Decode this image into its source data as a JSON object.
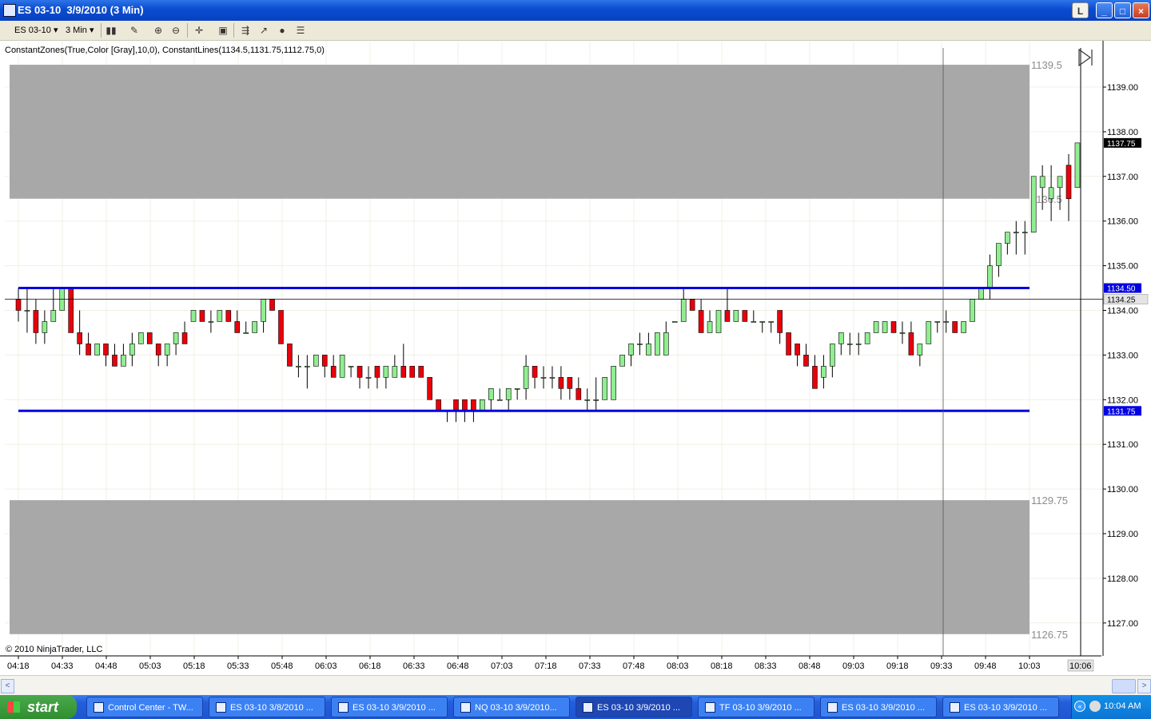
{
  "window": {
    "title": "ES 03-10  3/9/2010 (3 Min)",
    "buttons": {
      "l": "L",
      "minimize": "_",
      "maximize": "□",
      "close": "×"
    }
  },
  "toolbar": {
    "instrument": "ES 03-10",
    "interval": "3 Min",
    "icons": [
      "candlestick-icon",
      "pencil-draw-icon",
      "zoom-in-icon",
      "zoom-out-icon",
      "crosshair-icon",
      "properties-icon",
      "strategy-icon",
      "indicator-icon",
      "circle-icon",
      "data-box-icon"
    ]
  },
  "chart_data": {
    "type": "candlestick",
    "indicator_label": "ConstantZones(True,Color [Gray],10,0), ConstantLines(1134.5,1131.75,1112.75,0)",
    "copyright": "© 2010 NinjaTrader, LLC",
    "ylim": [
      1126.5,
      1139.75
    ],
    "y_ticks": [
      "1139.00",
      "1138.00",
      "1137.00",
      "1136.00",
      "1135.00",
      "1134.00",
      "1133.00",
      "1132.00",
      "1131.00",
      "1130.00",
      "1129.00",
      "1128.00",
      "1127.00"
    ],
    "x_ticks": [
      "04:18",
      "04:33",
      "04:48",
      "05:03",
      "05:18",
      "05:33",
      "05:48",
      "06:03",
      "06:18",
      "06:33",
      "06:48",
      "07:03",
      "07:18",
      "07:33",
      "07:48",
      "08:03",
      "08:18",
      "08:33",
      "08:48",
      "09:03",
      "09:18",
      "09:33",
      "09:48",
      "10:03"
    ],
    "x_end_label": "10:06",
    "zones": [
      {
        "from": 1136.5,
        "to": 1139.5,
        "color": "#a8a8a8",
        "top_label": "1139.5",
        "bottom_label": "1136.5"
      },
      {
        "from": 1126.75,
        "to": 1129.75,
        "color": "#a8a8a8",
        "top_label": "1129.75",
        "bottom_label": "1126.75"
      }
    ],
    "lines": [
      {
        "value": 1134.5,
        "color": "#0000e0",
        "label": "1134.50"
      },
      {
        "value": 1131.75,
        "color": "#0000e0",
        "label": "1131.75"
      }
    ],
    "last_price": {
      "value": 1137.75,
      "label": "1137.75"
    },
    "crosshair": {
      "value": 1134.25,
      "label": "1134.25",
      "time": "09:33"
    },
    "up_color": "#90ee90",
    "down_color": "#e8000b",
    "candles": [
      [
        1134.25,
        1134.5,
        1133.75,
        1134.0
      ],
      [
        1134.0,
        1134.5,
        1133.5,
        1134.0
      ],
      [
        1134.0,
        1134.25,
        1133.25,
        1133.5
      ],
      [
        1133.5,
        1134.0,
        1133.25,
        1133.75
      ],
      [
        1133.75,
        1134.5,
        1133.75,
        1134.0
      ],
      [
        1134.0,
        1134.5,
        1134.0,
        1134.5
      ],
      [
        1134.5,
        1134.5,
        1133.5,
        1133.5
      ],
      [
        1133.5,
        1134.0,
        1133.0,
        1133.25
      ],
      [
        1133.25,
        1133.5,
        1133.0,
        1133.0
      ],
      [
        1133.0,
        1133.25,
        1133.0,
        1133.25
      ],
      [
        1133.25,
        1133.25,
        1132.75,
        1133.0
      ],
      [
        1133.0,
        1133.25,
        1132.75,
        1132.75
      ],
      [
        1132.75,
        1133.25,
        1132.75,
        1133.0
      ],
      [
        1133.0,
        1133.5,
        1132.75,
        1133.25
      ],
      [
        1133.25,
        1133.5,
        1133.25,
        1133.5
      ],
      [
        1133.5,
        1133.5,
        1133.25,
        1133.25
      ],
      [
        1133.25,
        1133.25,
        1132.75,
        1133.0
      ],
      [
        1133.0,
        1133.25,
        1132.75,
        1133.25
      ],
      [
        1133.25,
        1133.5,
        1133.0,
        1133.5
      ],
      [
        1133.5,
        1133.75,
        1133.25,
        1133.25
      ],
      [
        1133.75,
        1134.0,
        1133.75,
        1134.0
      ],
      [
        1134.0,
        1134.0,
        1133.75,
        1133.75
      ],
      [
        1133.75,
        1134.0,
        1133.5,
        1133.75
      ],
      [
        1133.75,
        1134.0,
        1133.75,
        1134.0
      ],
      [
        1134.0,
        1134.0,
        1133.75,
        1133.75
      ],
      [
        1133.75,
        1134.0,
        1133.5,
        1133.5
      ],
      [
        1133.5,
        1133.75,
        1133.5,
        1133.5
      ],
      [
        1133.5,
        1133.75,
        1133.5,
        1133.75
      ],
      [
        1133.75,
        1134.25,
        1133.5,
        1134.25
      ],
      [
        1134.25,
        1134.25,
        1134.0,
        1134.0
      ],
      [
        1134.0,
        1134.0,
        1133.25,
        1133.25
      ],
      [
        1133.25,
        1133.25,
        1132.75,
        1132.75
      ],
      [
        1132.75,
        1133.0,
        1132.5,
        1132.75
      ],
      [
        1132.75,
        1133.0,
        1132.25,
        1132.75
      ],
      [
        1132.75,
        1133.0,
        1132.75,
        1133.0
      ],
      [
        1133.0,
        1133.0,
        1132.5,
        1132.75
      ],
      [
        1132.75,
        1133.0,
        1132.5,
        1132.5
      ],
      [
        1132.5,
        1133.0,
        1132.5,
        1133.0
      ],
      [
        1132.75,
        1132.75,
        1132.5,
        1132.75
      ],
      [
        1132.75,
        1132.75,
        1132.25,
        1132.5
      ],
      [
        1132.5,
        1132.75,
        1132.25,
        1132.5
      ],
      [
        1132.75,
        1132.75,
        1132.25,
        1132.5
      ],
      [
        1132.5,
        1132.75,
        1132.25,
        1132.75
      ],
      [
        1132.5,
        1133.0,
        1132.5,
        1132.75
      ],
      [
        1132.75,
        1133.25,
        1132.5,
        1132.5
      ],
      [
        1132.75,
        1132.75,
        1132.5,
        1132.5
      ],
      [
        1132.75,
        1132.75,
        1132.5,
        1132.5
      ],
      [
        1132.5,
        1132.5,
        1132.0,
        1132.0
      ],
      [
        1132.0,
        1132.0,
        1131.75,
        1131.75
      ],
      [
        1131.75,
        1131.75,
        1131.5,
        1131.75
      ],
      [
        1132.0,
        1132.0,
        1131.5,
        1131.75
      ],
      [
        1132.0,
        1132.0,
        1131.5,
        1131.75
      ],
      [
        1132.0,
        1132.0,
        1131.5,
        1131.75
      ],
      [
        1131.75,
        1132.0,
        1131.75,
        1132.0
      ],
      [
        1132.0,
        1132.25,
        1131.75,
        1132.25
      ],
      [
        1132.0,
        1132.25,
        1132.0,
        1132.0
      ],
      [
        1132.0,
        1132.25,
        1131.75,
        1132.25
      ],
      [
        1132.25,
        1132.25,
        1132.0,
        1132.25
      ],
      [
        1132.25,
        1133.0,
        1132.0,
        1132.75
      ],
      [
        1132.75,
        1132.75,
        1132.25,
        1132.5
      ],
      [
        1132.5,
        1132.75,
        1132.25,
        1132.5
      ],
      [
        1132.5,
        1132.75,
        1132.25,
        1132.5
      ],
      [
        1132.5,
        1132.75,
        1132.0,
        1132.25
      ],
      [
        1132.5,
        1132.5,
        1132.0,
        1132.25
      ],
      [
        1132.25,
        1132.5,
        1132.0,
        1132.0
      ],
      [
        1132.0,
        1132.25,
        1131.75,
        1132.0
      ],
      [
        1132.0,
        1132.5,
        1131.75,
        1132.0
      ],
      [
        1132.0,
        1132.5,
        1132.0,
        1132.5
      ],
      [
        1132.0,
        1132.75,
        1132.0,
        1132.75
      ],
      [
        1132.75,
        1133.0,
        1132.75,
        1133.0
      ],
      [
        1133.0,
        1133.25,
        1132.75,
        1133.25
      ],
      [
        1133.25,
        1133.5,
        1133.0,
        1133.25
      ],
      [
        1133.0,
        1133.5,
        1133.0,
        1133.25
      ],
      [
        1133.0,
        1133.5,
        1133.0,
        1133.5
      ],
      [
        1133.0,
        1133.75,
        1133.0,
        1133.5
      ],
      [
        1133.75,
        1133.75,
        1133.75,
        1133.75
      ],
      [
        1133.75,
        1134.5,
        1133.75,
        1134.25
      ],
      [
        1134.25,
        1134.25,
        1134.0,
        1134.0
      ],
      [
        1134.0,
        1134.25,
        1133.5,
        1133.5
      ],
      [
        1133.5,
        1134.0,
        1133.5,
        1133.75
      ],
      [
        1133.5,
        1134.0,
        1133.5,
        1134.0
      ],
      [
        1134.0,
        1134.5,
        1133.75,
        1133.75
      ],
      [
        1133.75,
        1134.0,
        1133.75,
        1134.0
      ],
      [
        1134.0,
        1134.0,
        1133.75,
        1133.75
      ],
      [
        1133.75,
        1134.0,
        1133.75,
        1133.75
      ],
      [
        1133.75,
        1133.75,
        1133.5,
        1133.75
      ],
      [
        1133.75,
        1133.75,
        1133.5,
        1133.75
      ],
      [
        1134.0,
        1134.0,
        1133.25,
        1133.5
      ],
      [
        1133.5,
        1133.5,
        1133.0,
        1133.0
      ],
      [
        1133.25,
        1133.25,
        1132.75,
        1133.0
      ],
      [
        1133.0,
        1133.25,
        1132.75,
        1132.75
      ],
      [
        1132.75,
        1133.0,
        1132.25,
        1132.25
      ],
      [
        1132.5,
        1133.0,
        1132.25,
        1132.75
      ],
      [
        1132.75,
        1133.25,
        1132.5,
        1133.25
      ],
      [
        1133.25,
        1133.5,
        1133.0,
        1133.5
      ],
      [
        1133.25,
        1133.5,
        1133.0,
        1133.25
      ],
      [
        1133.25,
        1133.5,
        1133.0,
        1133.25
      ],
      [
        1133.25,
        1133.5,
        1133.25,
        1133.5
      ],
      [
        1133.5,
        1133.75,
        1133.5,
        1133.75
      ],
      [
        1133.5,
        1133.75,
        1133.5,
        1133.75
      ],
      [
        1133.75,
        1133.75,
        1133.5,
        1133.5
      ],
      [
        1133.5,
        1133.75,
        1133.25,
        1133.5
      ],
      [
        1133.5,
        1133.75,
        1133.0,
        1133.0
      ],
      [
        1133.0,
        1133.25,
        1132.75,
        1133.25
      ],
      [
        1133.25,
        1133.75,
        1133.25,
        1133.75
      ],
      [
        1133.75,
        1133.75,
        1133.5,
        1133.75
      ],
      [
        1133.75,
        1134.0,
        1133.5,
        1133.75
      ],
      [
        1133.75,
        1133.75,
        1133.5,
        1133.5
      ],
      [
        1133.5,
        1133.75,
        1133.5,
        1133.75
      ],
      [
        1133.75,
        1134.25,
        1133.75,
        1134.25
      ],
      [
        1134.25,
        1134.5,
        1134.25,
        1134.5
      ],
      [
        1134.5,
        1135.25,
        1134.25,
        1135.0
      ],
      [
        1135.0,
        1135.5,
        1134.75,
        1135.5
      ],
      [
        1135.5,
        1135.75,
        1135.25,
        1135.75
      ],
      [
        1135.75,
        1136.0,
        1135.25,
        1135.75
      ],
      [
        1135.75,
        1136.0,
        1135.25,
        1135.75
      ],
      [
        1135.75,
        1137.0,
        1135.75,
        1137.0
      ],
      [
        1136.75,
        1137.25,
        1136.25,
        1137.0
      ],
      [
        1136.5,
        1137.25,
        1136.0,
        1136.75
      ],
      [
        1136.75,
        1137.0,
        1136.25,
        1137.0
      ],
      [
        1137.25,
        1137.5,
        1136.0,
        1136.5
      ],
      [
        1136.75,
        1137.75,
        1136.75,
        1137.75
      ]
    ]
  },
  "scrollbar": {
    "left_arrow": "<",
    "right_arrow": ">"
  },
  "taskbar": {
    "start_label": "start",
    "items": [
      {
        "label": "Control Center - TW...",
        "active": false
      },
      {
        "label": "ES 03-10  3/8/2010 ...",
        "active": false
      },
      {
        "label": "ES 03-10  3/9/2010 ...",
        "active": false
      },
      {
        "label": "NQ 03-10  3/9/2010...",
        "active": false
      },
      {
        "label": "ES 03-10  3/9/2010 ...",
        "active": true
      },
      {
        "label": "TF 03-10  3/9/2010 ...",
        "active": false
      },
      {
        "label": "ES 03-10  3/9/2010 ...",
        "active": false
      },
      {
        "label": "ES 03-10  3/9/2010 ...",
        "active": false
      }
    ],
    "clock": "10:04 AM"
  }
}
